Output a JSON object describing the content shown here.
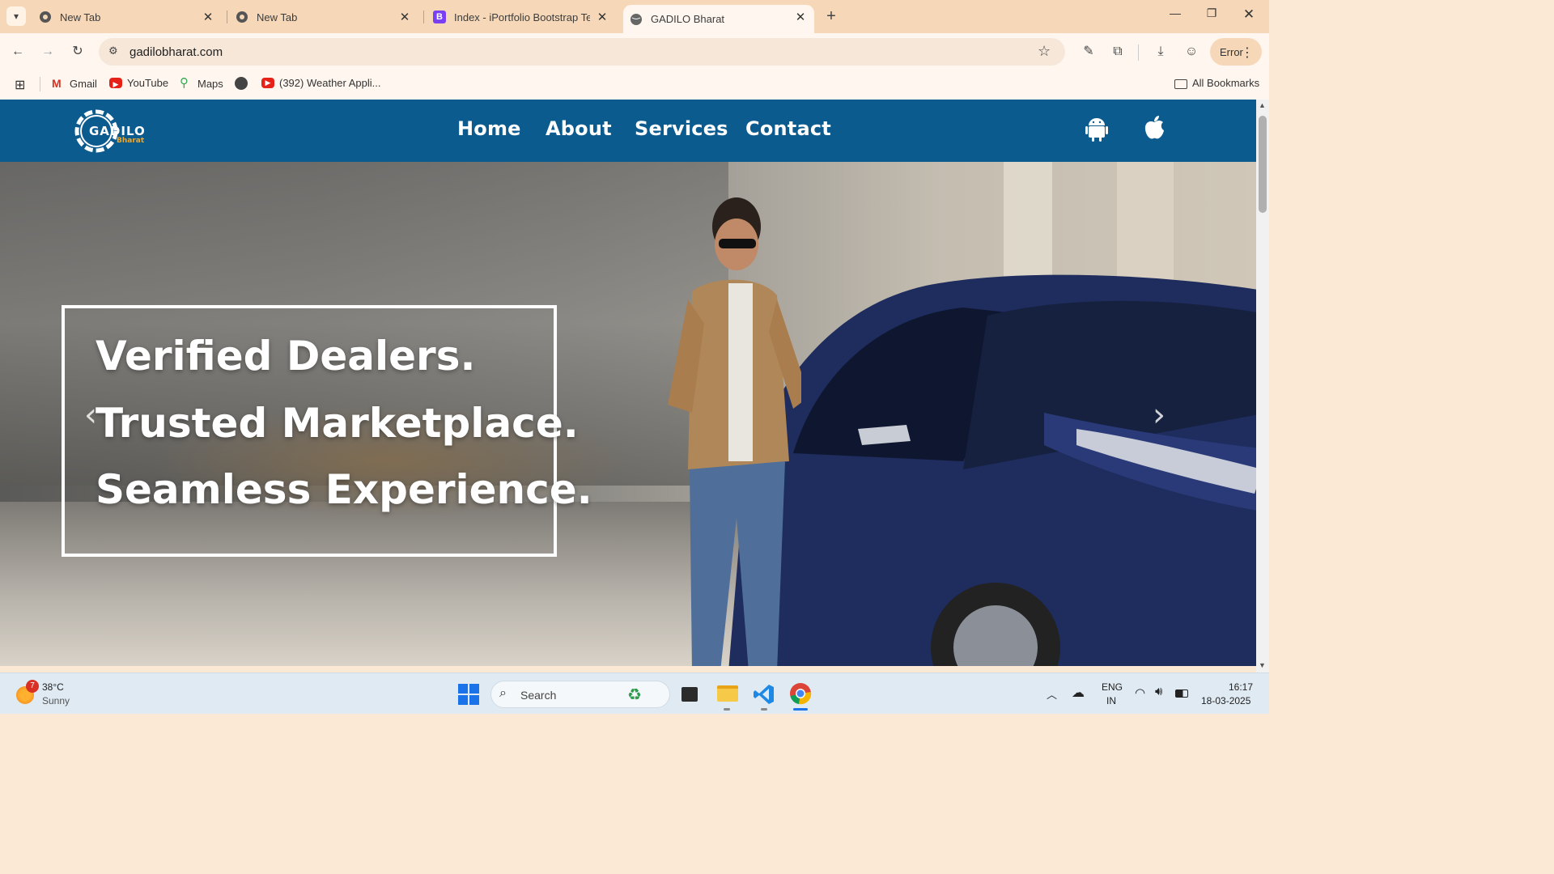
{
  "browser": {
    "tabs": [
      {
        "title": "New Tab",
        "active": false
      },
      {
        "title": "New Tab",
        "active": false
      },
      {
        "title": "Index - iPortfolio Bootstrap Ten",
        "active": false
      },
      {
        "title": "GADILO Bharat",
        "active": true
      }
    ],
    "url": "gadilobharat.com",
    "profile_button": "Error",
    "bookmarks": [
      "Gmail",
      "YouTube",
      "Maps",
      "(392) Weather Appli..."
    ],
    "all_bookmarks": "All Bookmarks"
  },
  "site": {
    "logo_main": "GADILO",
    "logo_sub": "Bharat",
    "nav": [
      "Home",
      "About",
      "Services",
      "Contact"
    ],
    "hero_lines": [
      "Verified Dealers.",
      "Trusted Marketplace.",
      "Seamless Experience."
    ]
  },
  "taskbar": {
    "weather_temp": "38°C",
    "weather_desc": "Sunny",
    "weather_badge": "7",
    "search": "Search",
    "lang1": "ENG",
    "lang2": "IN",
    "time": "16:17",
    "date": "18-03-2025"
  },
  "colors": {
    "nav_bg": "#0b5b8f",
    "tab_strip": "#f6d8b8",
    "logo_accent": "#f5a623"
  }
}
